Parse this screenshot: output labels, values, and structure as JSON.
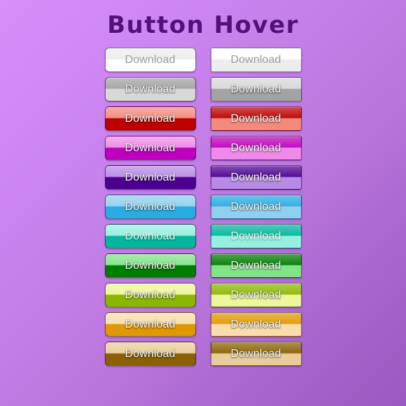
{
  "page": {
    "title": "Button Hover",
    "background_top_color": "#d78ffa",
    "background_bottom_color": "#9a59c0",
    "title_color": "#53107a"
  },
  "columns": [
    {
      "key": "normal",
      "state": "normal"
    },
    {
      "key": "hover",
      "state": "hover"
    }
  ],
  "button_label": "Download",
  "buttons": {
    "white": {
      "label": "Download",
      "top_color": "#ededed",
      "bottom_color": "#ffffff",
      "text_style": "dark"
    },
    "grey": {
      "label": "Download",
      "top_color": "#a3a3a3",
      "bottom_color": "#d8d8d8",
      "text_style": "light"
    },
    "red": {
      "label": "Download",
      "top_color": "#f4897d",
      "bottom_color": "#bd0000",
      "text_style": "light"
    },
    "magenta": {
      "label": "Download",
      "top_color": "#ef8ae9",
      "bottom_color": "#bd00bd",
      "text_style": "light"
    },
    "violet": {
      "label": "Download",
      "top_color": "#b78ae6",
      "bottom_color": "#4b0090",
      "text_style": "light"
    },
    "blue": {
      "label": "Download",
      "top_color": "#8fd0ee",
      "bottom_color": "#2aabe2",
      "text_style": "light"
    },
    "teal": {
      "label": "Download",
      "top_color": "#96f0df",
      "bottom_color": "#00b69b",
      "text_style": "mute"
    },
    "green": {
      "label": "Download",
      "top_color": "#81e489",
      "bottom_color": "#007d00",
      "text_style": "light"
    },
    "lime": {
      "label": "Download",
      "top_color": "#edf69a",
      "bottom_color": "#8cb700",
      "text_style": "light"
    },
    "orange": {
      "label": "Download",
      "top_color": "#f9ddab",
      "bottom_color": "#e09800",
      "text_style": "light"
    },
    "brown": {
      "label": "Download",
      "top_color": "#e8cd9a",
      "bottom_color": "#8a6000",
      "text_style": "light"
    }
  },
  "rows": [
    "white",
    "grey",
    "red",
    "magenta",
    "violet",
    "blue",
    "teal",
    "green",
    "lime",
    "orange",
    "brown"
  ]
}
